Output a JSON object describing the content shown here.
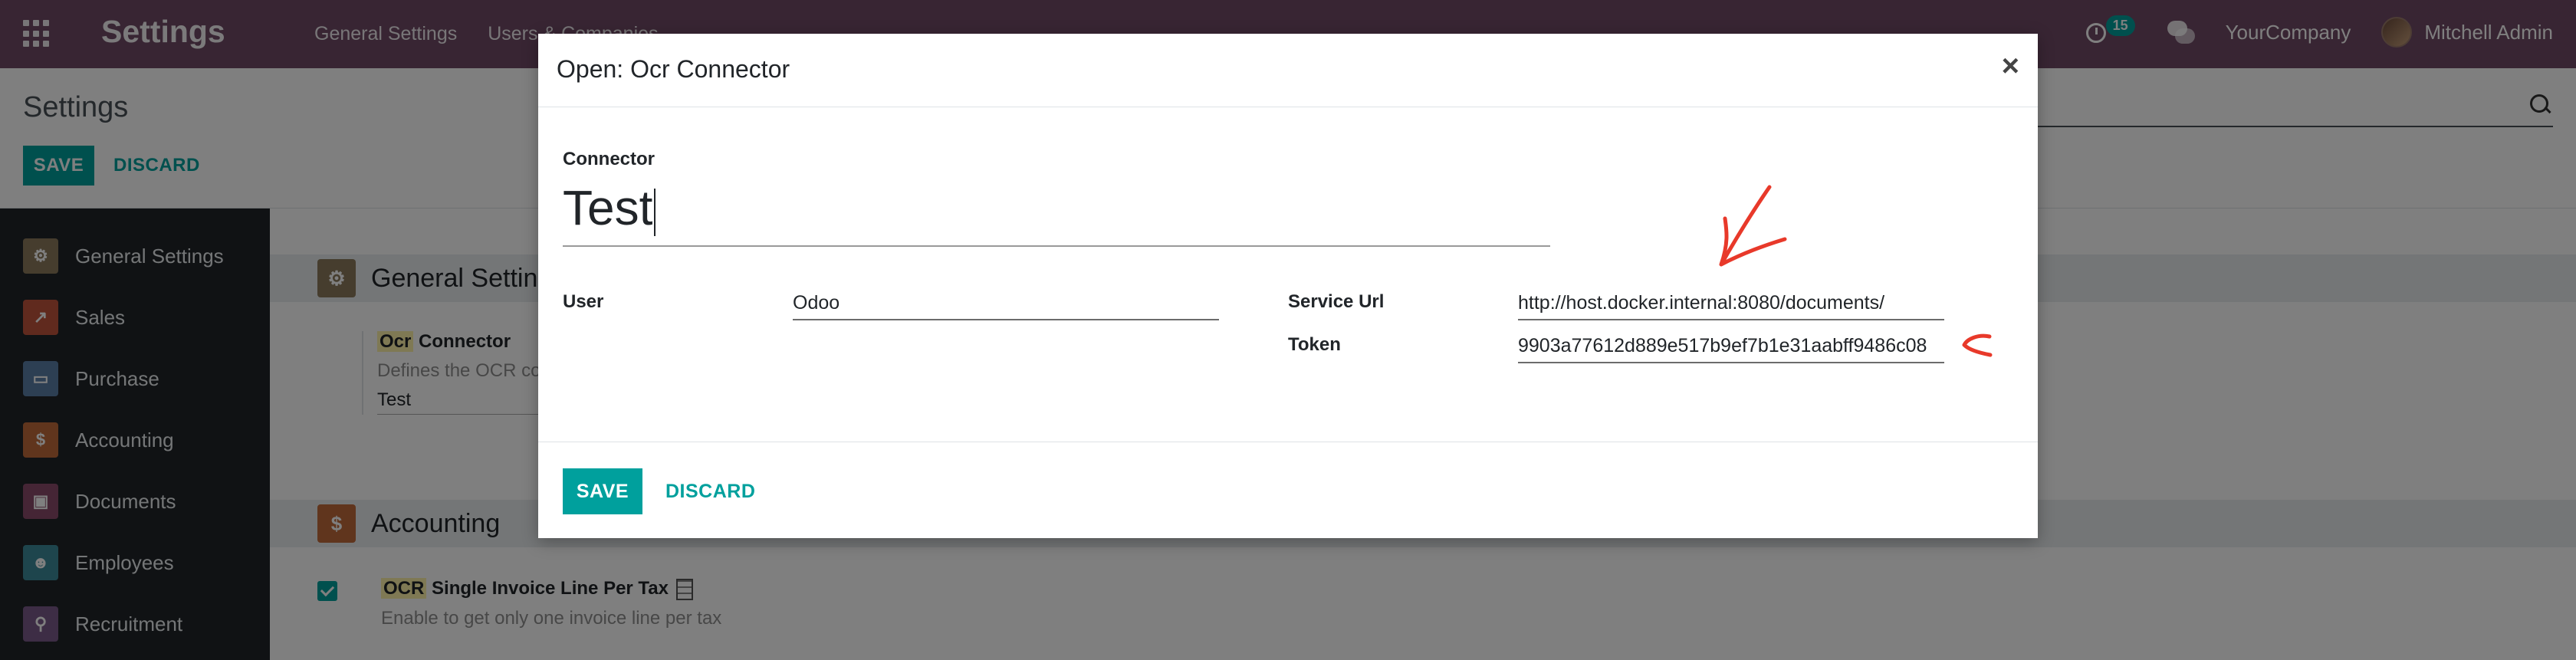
{
  "navbar": {
    "brand": "Settings",
    "menu": [
      "General Settings",
      "Users & Companies"
    ],
    "activity_count": "15",
    "company": "YourCompany",
    "user": "Mitchell Admin"
  },
  "control_panel": {
    "breadcrumb": "Settings",
    "save_label": "SAVE",
    "discard_label": "DISCARD"
  },
  "sidebar": {
    "items": [
      {
        "label": "General Settings",
        "icon": "gear-icon",
        "color": "#8c7b5d"
      },
      {
        "label": "Sales",
        "icon": "chart-icon",
        "color": "#c1553d"
      },
      {
        "label": "Purchase",
        "icon": "card-icon",
        "color": "#5b7ea6"
      },
      {
        "label": "Accounting",
        "icon": "dollar-doc-icon",
        "color": "#c06b3a"
      },
      {
        "label": "Documents",
        "icon": "box-icon",
        "color": "#8a4a6a"
      },
      {
        "label": "Employees",
        "icon": "people-icon",
        "color": "#3d8b9a"
      },
      {
        "label": "Recruitment",
        "icon": "search-person-icon",
        "color": "#7a5a8a"
      }
    ]
  },
  "main": {
    "general_section": "General Settings",
    "ocr_title_hl": "Ocr",
    "ocr_title_rest": " Connector",
    "ocr_desc": "Defines the OCR connector",
    "ocr_value": "Test",
    "accounting_section": "Accounting",
    "invoice_title_hl": "OCR",
    "invoice_title_rest": " Single Invoice Line Per Tax",
    "invoice_desc": "Enable to get only one invoice line per tax"
  },
  "modal": {
    "title": "Open: Ocr Connector",
    "close": "×",
    "connector_label": "Connector",
    "connector_value": "Test",
    "user_label": "User",
    "user_value": "Odoo",
    "service_url_label": "Service Url",
    "service_url_value": "http://host.docker.internal:8080/documents/",
    "token_label": "Token",
    "token_value": "9903a77612d889e517b9ef7b1e31aabff9486c08",
    "save_label": "SAVE",
    "discard_label": "DISCARD"
  },
  "colors": {
    "navbar": "#714b67",
    "accent": "#00a09d",
    "annotation": "#e8392a"
  }
}
